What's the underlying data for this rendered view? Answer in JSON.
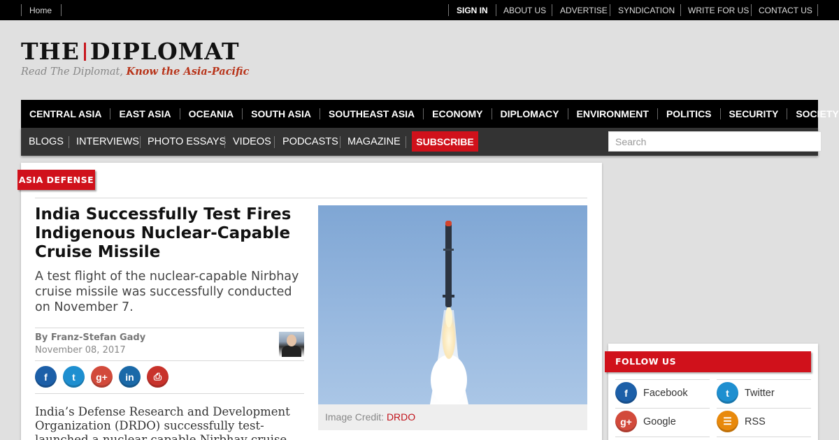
{
  "topbar": {
    "home": "Home",
    "sign_in": "SIGN IN",
    "links": [
      "ABOUT US",
      "ADVERTISE",
      "SYNDICATION",
      "WRITE FOR US",
      "CONTACT US"
    ]
  },
  "logo": {
    "left": "THE",
    "right": "DIPLOMAT",
    "tagline_plain": "Read The Diplomat, ",
    "tagline_bold": "Know the Asia-Pacific"
  },
  "nav_primary": [
    "CENTRAL ASIA",
    "EAST ASIA",
    "OCEANIA",
    "SOUTH ASIA",
    "SOUTHEAST ASIA",
    "ECONOMY",
    "DIPLOMACY",
    "ENVIRONMENT",
    "POLITICS",
    "SECURITY",
    "SOCIETY"
  ],
  "nav_secondary": [
    "BLOGS",
    "INTERVIEWS",
    "PHOTO ESSAYS",
    "VIDEOS",
    "PODCASTS",
    "MAGAZINE"
  ],
  "subscribe_label": "SUBSCRIBE",
  "search_placeholder": "Search",
  "article": {
    "section": "ASIA DEFENSE",
    "title": "India Successfully Test Fires Indigenous Nuclear-Capable Cruise Missile",
    "subtitle": "A test flight of the nuclear-capable Nirbhay cruise missile was successfully conducted on November 7.",
    "by": "By ",
    "author": "Franz-Stefan Gady",
    "date": "November 08, 2017",
    "body": "India’s Defense Research and Development Organization (DRDO) successfully test-launched a nuclear capable Nirbhay cruise",
    "image_credit_label": "Image Credit: ",
    "image_credit_source": "DRDO"
  },
  "share_icons": [
    {
      "icon": "facebook-icon",
      "glyph": "f",
      "color": "#1c5fa8"
    },
    {
      "icon": "twitter-icon",
      "glyph": "t",
      "color": "#1e8fd0"
    },
    {
      "icon": "google-plus-icon",
      "glyph": "g+",
      "color": "#d24a3b"
    },
    {
      "icon": "linkedin-icon",
      "glyph": "in",
      "color": "#1a69a8"
    },
    {
      "icon": "print-icon",
      "glyph": "⎙",
      "color": "#c8322b"
    }
  ],
  "follow": {
    "title": "FOLLOW US",
    "items": [
      {
        "label": "Facebook",
        "icon": "facebook-icon",
        "glyph": "f",
        "color": "#1c5fa8"
      },
      {
        "label": "Twitter",
        "icon": "twitter-icon",
        "glyph": "t",
        "color": "#1e8fd0"
      },
      {
        "label": "Google",
        "icon": "google-plus-icon",
        "glyph": "g+",
        "color": "#d24a3b"
      },
      {
        "label": "RSS",
        "icon": "rss-icon",
        "glyph": "☰",
        "color": "#e8890c"
      }
    ]
  }
}
